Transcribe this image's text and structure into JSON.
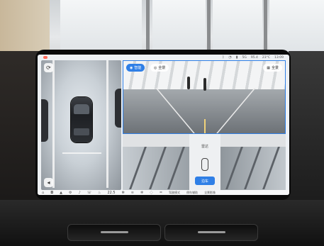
{
  "statusbar": {
    "icons": [
      "bluetooth-icon",
      "wifi-icon",
      "signal-icon"
    ],
    "carrier": "5G",
    "battery": "95.4",
    "temperature": "23°C",
    "clock": "13:09"
  },
  "camera": {
    "mode_active": "智能",
    "mode_plain": "全景",
    "view_button": "全景"
  },
  "middle_panel": {
    "title": "雷达",
    "button": "泊车"
  },
  "dock": {
    "temperature": "22.5",
    "right_items": [
      "驾驶模式",
      "倒车辅助",
      "全景影像"
    ]
  },
  "colors": {
    "accent": "#2f7fe6",
    "home_dot": "#ff6a5a"
  }
}
